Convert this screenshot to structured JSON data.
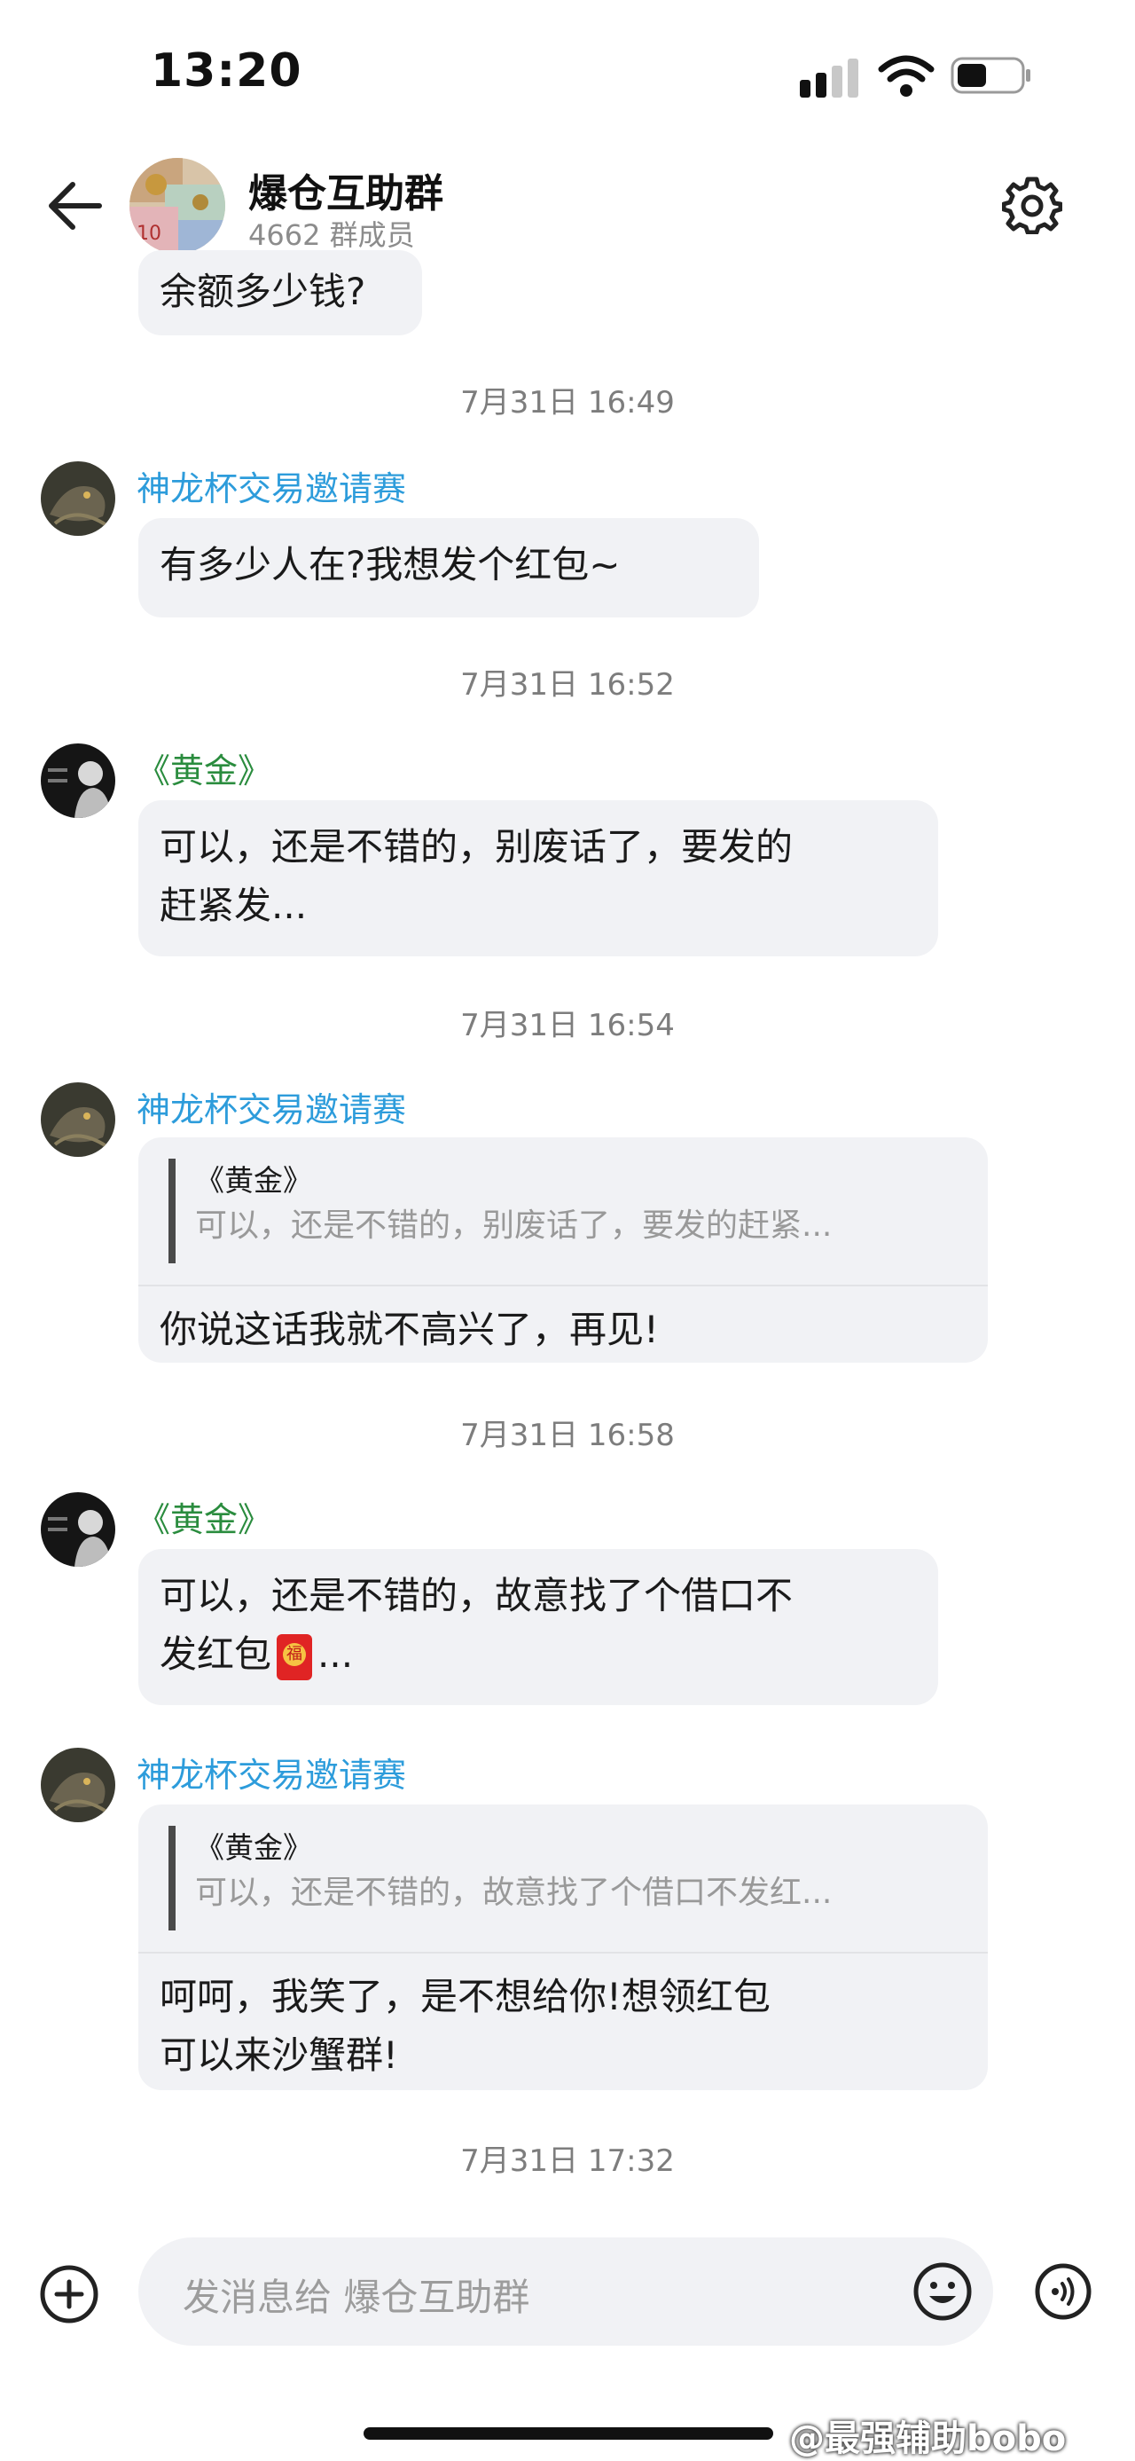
{
  "status_bar": {
    "time": "13:20"
  },
  "header": {
    "title": "爆仓互助群",
    "members": "4662 群成员"
  },
  "messages": {
    "m0_text": "余额多少钱?",
    "ts1": "7月31日 16:49",
    "m1_sender": "神龙杯交易邀请赛",
    "m1_text": "有多少人在?我想发个红包~",
    "ts2": "7月31日 16:52",
    "m2_sender": "《黄金》",
    "m2_line1": "可以，还是不错的，别废话了，要发的",
    "m2_line2": "赶紧发...",
    "ts3": "7月31日 16:54",
    "m3_sender": "神龙杯交易邀请赛",
    "m3_quote_name": "《黄金》",
    "m3_quote_text": "可以，还是不错的，别废话了，要发的赶紧...",
    "m3_reply": "你说这话我就不高兴了，再见!",
    "ts4": "7月31日 16:58",
    "m4_sender": "《黄金》",
    "m4_line1": "可以，还是不错的，故意找了个借口不",
    "m4_line2_a": "发红包",
    "m4_line2_b": "...",
    "m5_sender": "神龙杯交易邀请赛",
    "m5_quote_name": "《黄金》",
    "m5_quote_text": "可以，还是不错的，故意找了个借口不发红...",
    "m5_line1": "呵呵，我笑了，是不想给你!想领红包",
    "m5_line2": "可以来沙蟹群!",
    "ts5": "7月31日 17:32"
  },
  "input": {
    "placeholder": "发消息给 爆仓互助群"
  },
  "watermark": "@最强辅助bobo",
  "colors": {
    "sender_blue": "#2d9cdb",
    "sender_green": "#2a8c3e",
    "bubble": "#f1f2f5"
  },
  "icons": [
    "back-arrow-icon",
    "settings-gear-icon",
    "plus-icon",
    "emoji-icon",
    "voice-icon",
    "red-packet-emoji"
  ]
}
